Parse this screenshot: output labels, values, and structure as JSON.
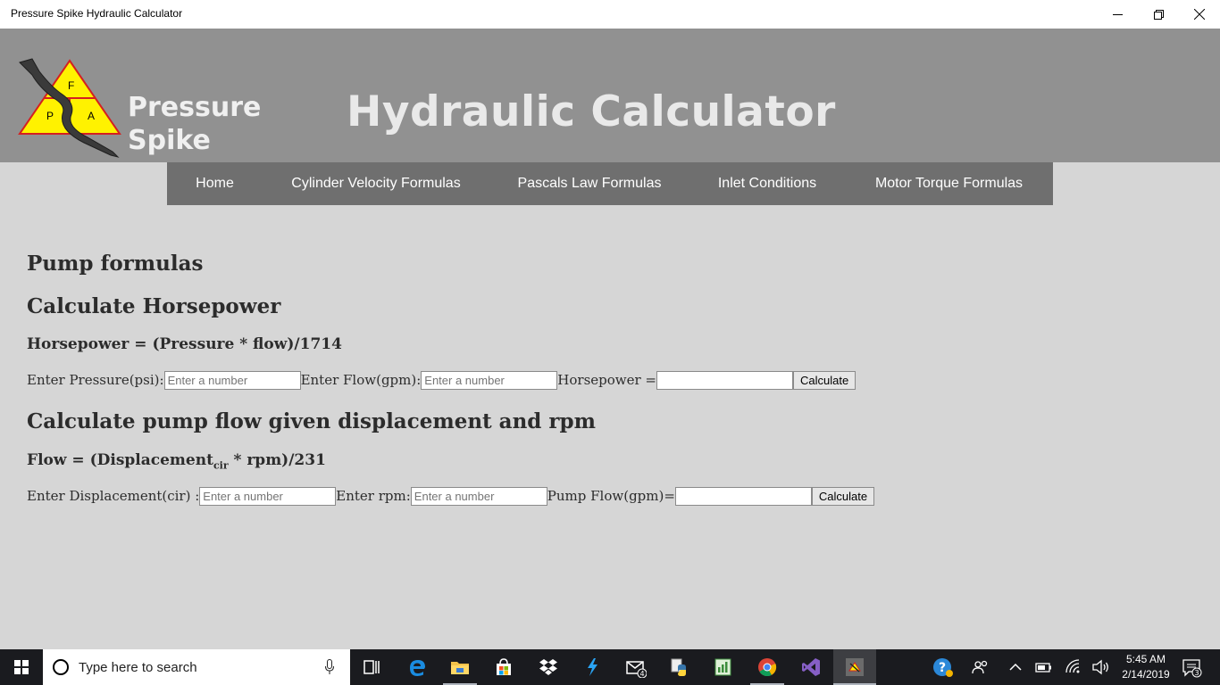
{
  "window": {
    "title": "Pressure Spike Hydraulic Calculator"
  },
  "header": {
    "brand_line1": "Pressure",
    "brand_line2": "Spike",
    "logo_letters": {
      "top": "F",
      "left": "P",
      "right": "A"
    },
    "title": "Hydraulic Calculator"
  },
  "nav": {
    "items": [
      "Home",
      "Cylinder Velocity Formulas",
      "Pascals Law Formulas",
      "Inlet Conditions",
      "Motor Torque Formulas"
    ]
  },
  "main": {
    "section_title": "Pump formulas",
    "horsepower": {
      "heading": "Calculate Horsepower",
      "formula": "Horsepower = (Pressure * flow)/1714",
      "pressure_label": "Enter Pressure(psi):",
      "pressure_placeholder": "Enter a number",
      "flow_label": "Enter Flow(gpm):",
      "flow_placeholder": "Enter a number",
      "result_label": "Horsepower =",
      "result_value": "",
      "button": "Calculate"
    },
    "pump_flow": {
      "heading": "Calculate pump flow given displacement and rpm",
      "formula_prefix": "Flow = (Displacement",
      "formula_sub": "cir",
      "formula_suffix": " * rpm)/231",
      "displacement_label": "Enter Displacement(cir) :",
      "displacement_placeholder": "Enter a number",
      "rpm_label": "Enter rpm:",
      "rpm_placeholder": "Enter a number",
      "result_label": "Pump Flow(gpm)=",
      "result_value": "",
      "button": "Calculate"
    }
  },
  "taskbar": {
    "search_placeholder": "Type here to search",
    "time": "5:45 AM",
    "date": "2/14/2019",
    "mail_badge": "4",
    "notification_count": "3"
  },
  "colors": {
    "header_bg": "#919191",
    "nav_bg": "#6f6f6f",
    "page_bg": "#d6d6d6",
    "taskbar_bg": "#1a1b1f"
  }
}
